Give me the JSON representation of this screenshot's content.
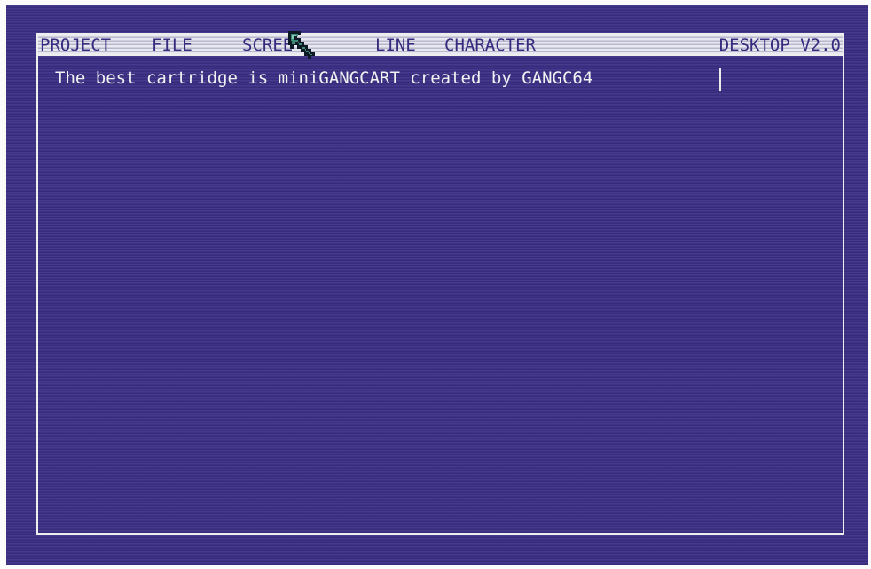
{
  "menubar": {
    "items": [
      {
        "label": "PROJECT"
      },
      {
        "label": "FILE"
      },
      {
        "label": "SCREE"
      },
      {
        "label": "LINE"
      },
      {
        "label": "CHARACTER"
      }
    ],
    "version_label": "DESKTOP V2.0"
  },
  "document": {
    "text": "The best cartridge is miniGANGCART created by GANGC64"
  },
  "colors": {
    "background": "#3b2f86",
    "menubar": "#d8d8e6",
    "menu_text": "#352a7e",
    "document_text": "#f2f2f2",
    "border": "#eeeeee"
  },
  "icons": [
    "arrow-pointer-icon",
    "text-cursor"
  ]
}
